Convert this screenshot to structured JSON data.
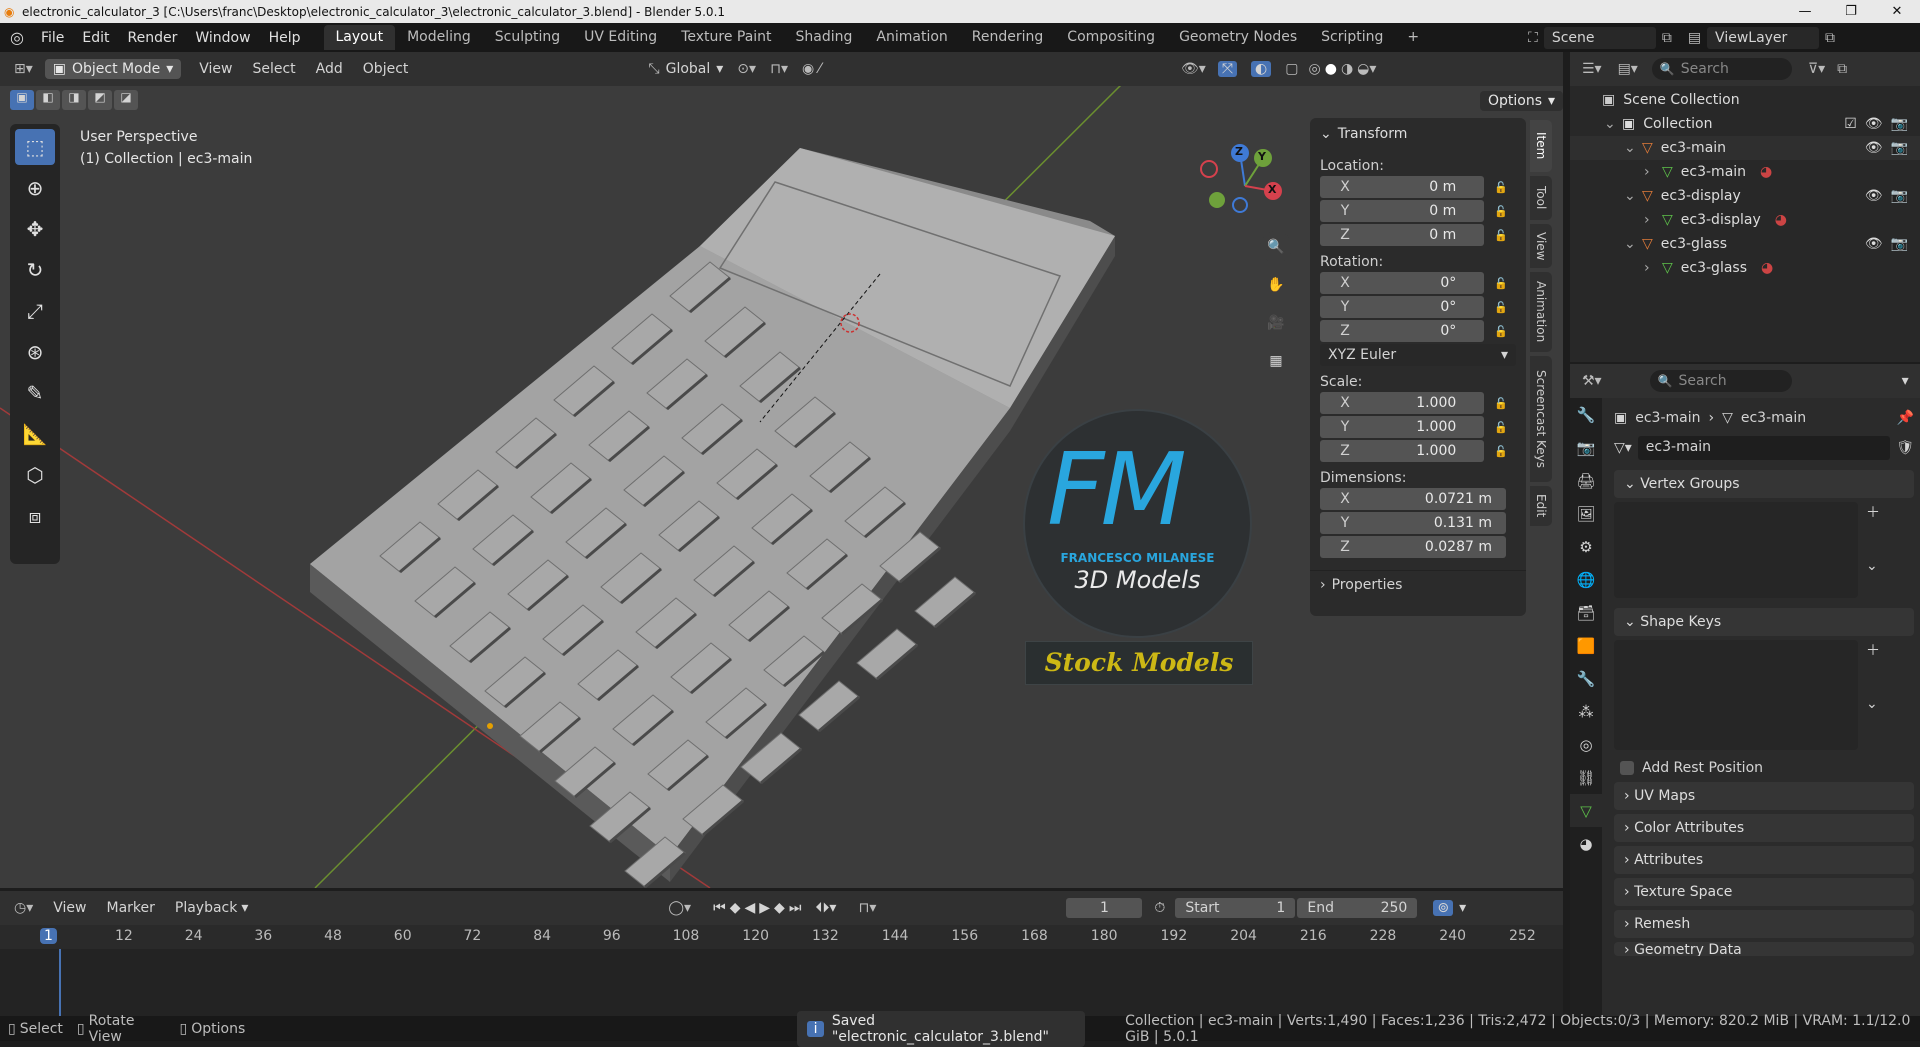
{
  "title_bar": {
    "text": "electronic_calculator_3 [C:\\Users\\franc\\Desktop\\electronic_calculator_3\\electronic_calculator_3.blend] - Blender 5.0.1",
    "controls": [
      "—",
      "❐",
      "✕"
    ]
  },
  "menu": [
    "File",
    "Edit",
    "Render",
    "Window",
    "Help"
  ],
  "workspaces": [
    "Layout",
    "Modeling",
    "Sculpting",
    "UV Editing",
    "Texture Paint",
    "Shading",
    "Animation",
    "Rendering",
    "Compositing",
    "Geometry Nodes",
    "Scripting"
  ],
  "active_workspace": "Layout",
  "scene": {
    "label": "Scene",
    "viewlayer": "ViewLayer"
  },
  "viewport_header": {
    "mode": "Object Mode",
    "menus": [
      "View",
      "Select",
      "Add",
      "Object"
    ],
    "orientation": "Global",
    "options": "Options"
  },
  "viewport": {
    "perspective": "User Perspective",
    "context": "(1) Collection | ec3-main",
    "gizmo_axes": [
      "Z",
      "Y",
      "X"
    ]
  },
  "watermark": {
    "fm": "FM",
    "name": "FRANCESCO MILANESE",
    "sub": "3D Models",
    "stock": "Stock Models"
  },
  "npanel": {
    "title": "Transform",
    "location_label": "Location:",
    "location": [
      {
        "a": "X",
        "v": "0 m"
      },
      {
        "a": "Y",
        "v": "0 m"
      },
      {
        "a": "Z",
        "v": "0 m"
      }
    ],
    "rotation_label": "Rotation:",
    "rotation": [
      {
        "a": "X",
        "v": "0°"
      },
      {
        "a": "Y",
        "v": "0°"
      },
      {
        "a": "Z",
        "v": "0°"
      }
    ],
    "rotation_mode": "XYZ Euler",
    "scale_label": "Scale:",
    "scale": [
      {
        "a": "X",
        "v": "1.000"
      },
      {
        "a": "Y",
        "v": "1.000"
      },
      {
        "a": "Z",
        "v": "1.000"
      }
    ],
    "dimensions_label": "Dimensions:",
    "dimensions": [
      {
        "a": "X",
        "v": "0.0721 m"
      },
      {
        "a": "Y",
        "v": "0.131 m"
      },
      {
        "a": "Z",
        "v": "0.0287 m"
      }
    ],
    "properties": "Properties",
    "tabs": [
      "Item",
      "Tool",
      "View",
      "Animation",
      "Screencast Keys",
      "Edit"
    ]
  },
  "outliner": {
    "search_placeholder": "Search",
    "rows": [
      {
        "label": "Scene Collection",
        "depth": 0
      },
      {
        "label": "Collection",
        "depth": 1
      },
      {
        "label": "ec3-main",
        "depth": 2
      },
      {
        "label": "ec3-main",
        "depth": 3
      },
      {
        "label": "ec3-display",
        "depth": 2
      },
      {
        "label": "ec3-display",
        "depth": 3
      },
      {
        "label": "ec3-glass",
        "depth": 2
      },
      {
        "label": "ec3-glass",
        "depth": 3
      }
    ]
  },
  "properties": {
    "search_placeholder": "Search",
    "breadcrumb": [
      "ec3-main",
      "ec3-main"
    ],
    "mesh_name": "ec3-main",
    "panels": {
      "vertex_groups": "Vertex Groups",
      "shape_keys": "Shape Keys",
      "add_rest": "Add Rest Position",
      "uv_maps": "UV Maps",
      "color_attributes": "Color Attributes",
      "attributes": "Attributes",
      "texture_space": "Texture Space",
      "remesh": "Remesh",
      "geometry_data": "Geometry Data"
    }
  },
  "timeline": {
    "menus": [
      "View",
      "Marker",
      "Playback"
    ],
    "current_frame": "1",
    "start_label": "Start",
    "start": "1",
    "end_label": "End",
    "end": "250",
    "ticks": [
      "1",
      "12",
      "24",
      "36",
      "48",
      "60",
      "72",
      "84",
      "96",
      "108",
      "120",
      "132",
      "144",
      "156",
      "168",
      "180",
      "192",
      "204",
      "216",
      "228",
      "240",
      "252"
    ]
  },
  "status": {
    "select": "Select",
    "rotate": "Rotate View",
    "options": "Options",
    "saved": "Saved \"electronic_calculator_3.blend\"",
    "info": "Collection | ec3-main | Verts:1,490 | Faces:1,236 | Tris:2,472 | Objects:0/3 | Memory: 820.2 MiB | VRAM: 1.1/12.0 GiB | 5.0.1"
  }
}
